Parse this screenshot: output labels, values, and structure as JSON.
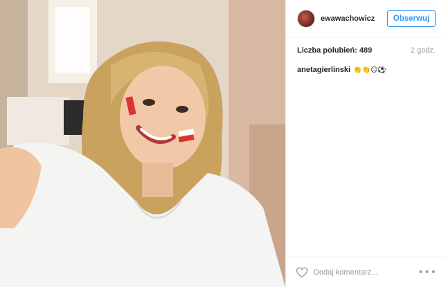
{
  "post": {
    "photo_alt": "",
    "header": {
      "username": "ewawachowicz",
      "follow_label": "Obserwuj"
    },
    "likes_label": "Liczba polubień: 489",
    "time_label": "2 godz.",
    "comments": [
      {
        "user": "anetagierlinski",
        "text": "👏👏☺⚽"
      }
    ],
    "footer": {
      "comment_placeholder": "Dodaj komentarz...",
      "more_label": "•••"
    }
  },
  "colors": {
    "accent": "#3897f0",
    "border": "#efefef",
    "muted": "#999999",
    "text": "#262626"
  },
  "icons": {
    "heart": "heart-outline-icon",
    "more": "more-dots-icon"
  }
}
